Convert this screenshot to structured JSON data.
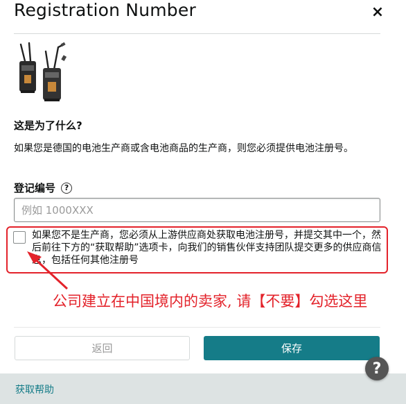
{
  "dialog": {
    "title": "Registration Number",
    "close_label": "×"
  },
  "product": {
    "icon": "battery-product-image"
  },
  "info": {
    "heading": "这是为了什么?",
    "description": "如果您是德国的电池生产商或含电池商品的生产商，则您必须提供电池注册号。"
  },
  "registration": {
    "label": "登记编号",
    "help_icon": "?",
    "input_value": "",
    "placeholder": "例如 1000XXX"
  },
  "checkbox": {
    "checked": false,
    "text": "如果您不是生产商，您必须从上游供应商处获取电池注册号，并提交其中一个，然后前往下方的“获取帮助”选项卡，向我们的销售伙伴支持团队提交更多的供应商信息，包括任何其他注册号"
  },
  "annotation": {
    "text": "公司建立在中国境内的卖家, 请【不要】勾选这里",
    "color": "#e3222a"
  },
  "actions": {
    "back_label": "返回",
    "save_label": "保存"
  },
  "footer": {
    "help_link": "获取帮助",
    "float_help": "?"
  },
  "colors": {
    "primary": "#157c88",
    "annotation": "#e3222a",
    "footer_bg": "#dde3e3"
  }
}
